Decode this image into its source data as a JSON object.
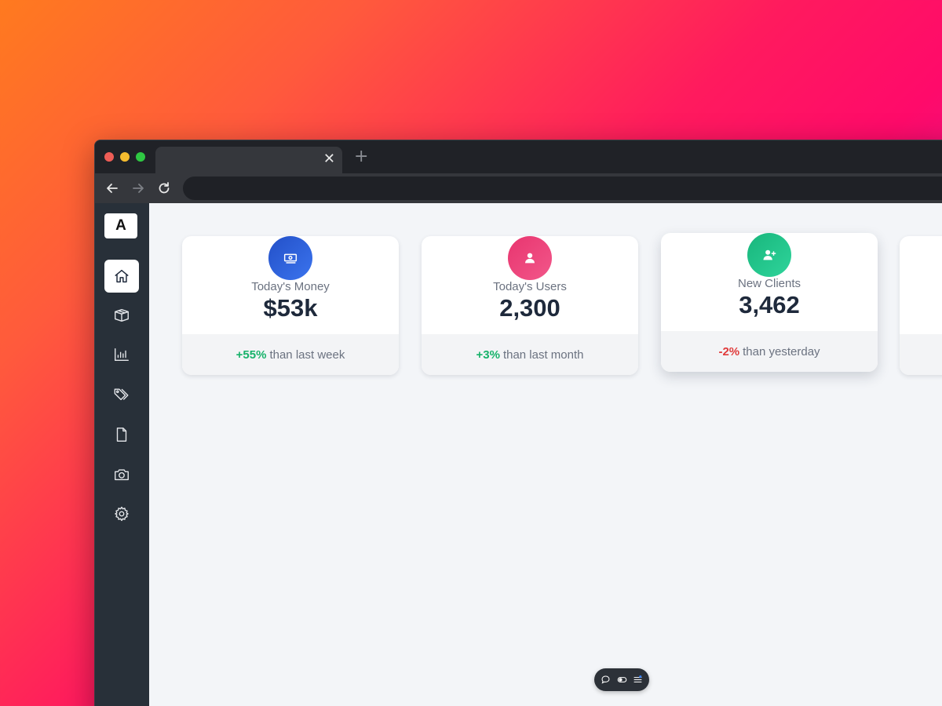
{
  "browser": {
    "tab_title": "",
    "tab_close_glyph": "✕",
    "new_tab_glyph": "+",
    "address_value": ""
  },
  "sidebar": {
    "logo_letter": "A",
    "items": [
      {
        "name": "home",
        "icon": "home-icon",
        "active": true
      },
      {
        "name": "box",
        "icon": "box-icon",
        "active": false
      },
      {
        "name": "chart",
        "icon": "bar-chart-icon",
        "active": false
      },
      {
        "name": "tags",
        "icon": "tags-icon",
        "active": false
      },
      {
        "name": "document",
        "icon": "document-icon",
        "active": false
      },
      {
        "name": "camera",
        "icon": "camera-icon",
        "active": false
      },
      {
        "name": "settings",
        "icon": "gear-icon",
        "active": false
      }
    ]
  },
  "cards": [
    {
      "label": "Today's Money",
      "value": "$53k",
      "delta": "+55%",
      "delta_trend": "positive",
      "footer_text": "than last week",
      "icon": "money-icon",
      "icon_color": "#2f5bd8"
    },
    {
      "label": "Today's Users",
      "value": "2,300",
      "delta": "+3%",
      "delta_trend": "positive",
      "footer_text": "than last month",
      "icon": "user-icon",
      "icon_color": "#ec407a"
    },
    {
      "label": "New Clients",
      "value": "3,462",
      "delta": "-2%",
      "delta_trend": "negative",
      "footer_text": "than yesterday",
      "icon": "add-user-icon",
      "icon_color": "#1fc48a"
    }
  ],
  "colors": {
    "positive": "#17b26a",
    "negative": "#e03b3b",
    "sidebar_bg": "#283039",
    "content_bg": "#f3f5f8"
  },
  "floating_toolbar": {
    "icons": [
      "comment-icon",
      "toggle-icon",
      "sliders-icon"
    ]
  }
}
